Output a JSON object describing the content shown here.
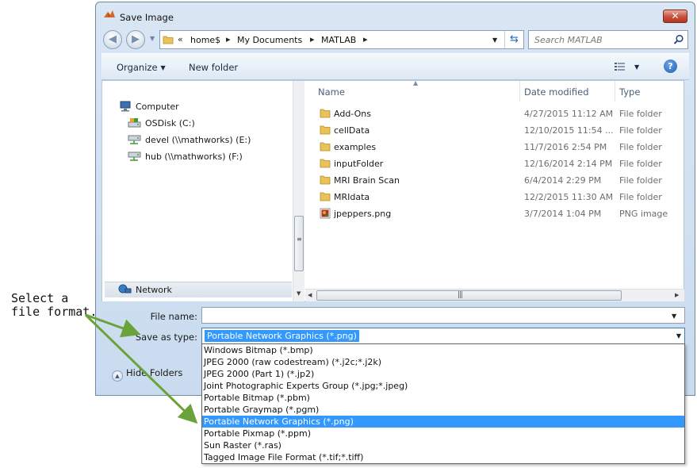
{
  "annotation": {
    "line1": "Select a",
    "line2": "file format."
  },
  "window": {
    "title": "Save Image",
    "close_label": "✕"
  },
  "navigation": {
    "back_glyph": "◀",
    "forward_glyph": "▶",
    "breadcrumb": {
      "overflow": "«",
      "items": [
        "home$",
        "My Documents",
        "MATLAB"
      ]
    },
    "search_placeholder": "Search MATLAB"
  },
  "toolbar": {
    "organize_label": "Organize",
    "new_folder_label": "New folder",
    "help_label": "?"
  },
  "nav_pane": {
    "items": [
      {
        "label": "Computer",
        "icon": "computer-icon"
      },
      {
        "label": "OSDisk (C:)",
        "icon": "drive-icon"
      },
      {
        "label": "devel (\\\\mathworks) (E:)",
        "icon": "network-drive-icon"
      },
      {
        "label": "hub (\\\\mathworks) (F:)",
        "icon": "network-drive-icon"
      }
    ],
    "network_label": "Network"
  },
  "file_list": {
    "columns": [
      "Name",
      "Date modified",
      "Type"
    ],
    "rows": [
      {
        "name": "Add-Ons",
        "date": "4/27/2015 11:12 AM",
        "type": "File folder",
        "icon": "folder-icon"
      },
      {
        "name": "cellData",
        "date": "12/10/2015 11:54 ...",
        "type": "File folder",
        "icon": "folder-icon"
      },
      {
        "name": "examples",
        "date": "11/7/2016 2:54 PM",
        "type": "File folder",
        "icon": "folder-icon"
      },
      {
        "name": "inputFolder",
        "date": "12/16/2014 2:14 PM",
        "type": "File folder",
        "icon": "folder-icon"
      },
      {
        "name": "MRI Brain Scan",
        "date": "6/4/2014 2:29 PM",
        "type": "File folder",
        "icon": "folder-icon"
      },
      {
        "name": "MRIdata",
        "date": "12/2/2015 11:30 AM",
        "type": "File folder",
        "icon": "folder-icon"
      },
      {
        "name": "jpeppers.png",
        "date": "3/7/2014 1:04 PM",
        "type": "PNG image",
        "icon": "png-image-icon"
      }
    ]
  },
  "form": {
    "file_name_label": "File name:",
    "file_name_value": "",
    "save_as_type_label": "Save as type:",
    "save_as_type_value": "Portable Network Graphics (*.png)",
    "hide_folders_label": "Hide Folders"
  },
  "type_options": [
    "Windows Bitmap (*.bmp)",
    "JPEG 2000 (raw codestream) (*.j2c;*.j2k)",
    "JPEG 2000 (Part 1) (*.jp2)",
    "Joint Photographic Experts Group (*.jpg;*.jpeg)",
    "Portable Bitmap (*.pbm)",
    "Portable Graymap (*.pgm)",
    "Portable Network Graphics (*.png)",
    "Portable Pixmap (*.ppm)",
    "Sun Raster (*.ras)",
    "Tagged Image File Format (*.tif;*.tiff)"
  ],
  "selected_type_index": 6,
  "colors": {
    "selection": "#3399ff",
    "annotation_arrow": "#6aa33a",
    "close_button": "#c7503d"
  }
}
